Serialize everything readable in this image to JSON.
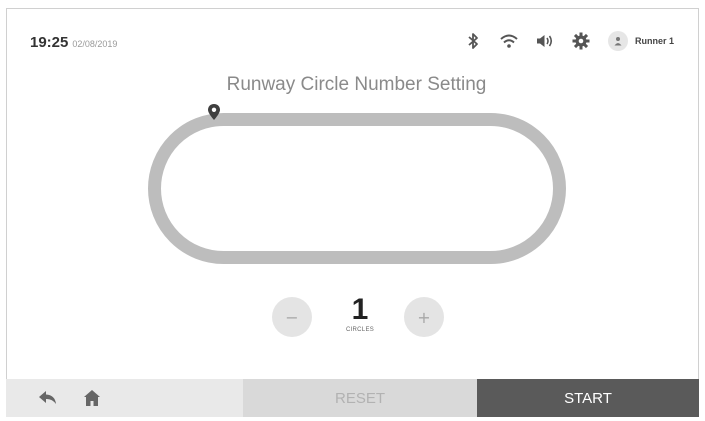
{
  "status_bar": {
    "time": "19:25",
    "date": "02/08/2019",
    "icons": [
      "bluetooth-icon",
      "wifi-icon",
      "volume-icon",
      "settings-icon"
    ],
    "user": {
      "name": "Runner 1",
      "icon": "user-icon"
    }
  },
  "page": {
    "title": "Runway Circle Number Setting"
  },
  "track": {
    "marker_icon": "location-pin-icon"
  },
  "counter": {
    "decrement_label": "−",
    "value": "1",
    "unit": "CIRCLES",
    "increment_label": "+"
  },
  "bottom_bar": {
    "back_icon": "back-icon",
    "home_icon": "home-icon",
    "reset_label": "RESET",
    "start_label": "START"
  },
  "colors": {
    "track": "#bdbdbd",
    "reset_bg": "#d9d9d9",
    "start_bg": "#5a5a5a",
    "nav_bg": "#e9e9e9"
  }
}
